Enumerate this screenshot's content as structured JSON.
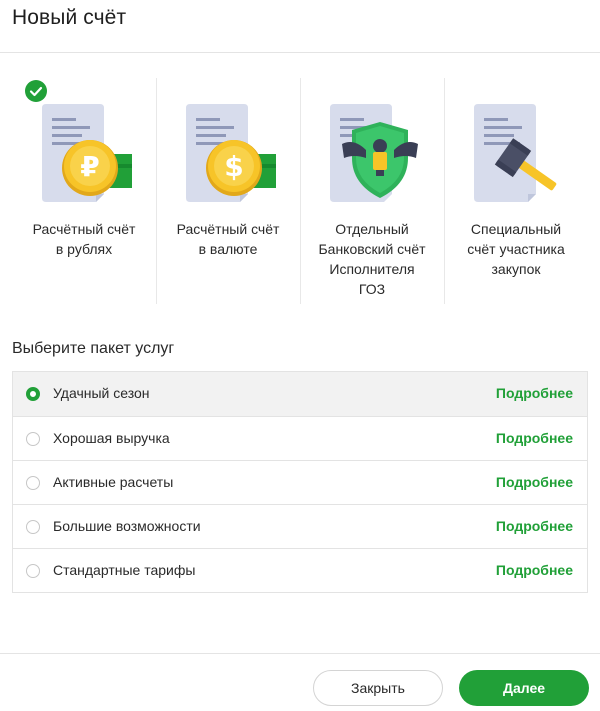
{
  "dialog": {
    "title": "Новый счёт"
  },
  "accounts": [
    {
      "label": "Расчётный счёт\nв рублях",
      "icon": "ruble-coin-document-icon",
      "selected": true
    },
    {
      "label": "Расчётный счёт\nв валюте",
      "icon": "dollar-coin-document-icon",
      "selected": false
    },
    {
      "label": "Отдельный\nБанковский счёт\nИсполнителя\nГОЗ",
      "icon": "eagle-shield-document-icon",
      "selected": false
    },
    {
      "label": "Специальный\nсчёт участника\nзакупок",
      "icon": "gavel-document-icon",
      "selected": false
    }
  ],
  "packages": {
    "title": "Выберите пакет услуг",
    "items": [
      {
        "name": "Удачный сезон",
        "more": "Подробнее",
        "selected": true
      },
      {
        "name": "Хорошая выручка",
        "more": "Подробнее",
        "selected": false
      },
      {
        "name": "Активные расчеты",
        "more": "Подробнее",
        "selected": false
      },
      {
        "name": "Большие возможности",
        "more": "Подробнее",
        "selected": false
      },
      {
        "name": "Стандартные тарифы",
        "more": "Подробнее",
        "selected": false
      }
    ]
  },
  "footer": {
    "close_label": "Закрыть",
    "next_label": "Далее"
  },
  "colors": {
    "accent": "#21a038",
    "coin": "#f7c428",
    "document": "#d7dcec",
    "shield": "#3cc66b"
  }
}
